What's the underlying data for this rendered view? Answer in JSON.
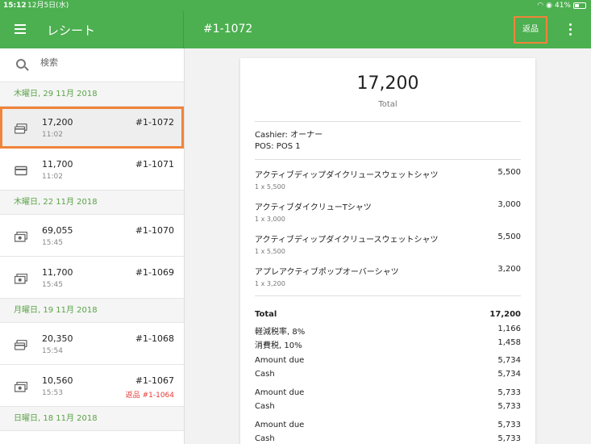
{
  "status": {
    "time": "15:12",
    "date": "12月5日(水)",
    "battery": "41%",
    "battery_level": 0.41
  },
  "appbar": {
    "title": "レシート",
    "receipt_title": "#1-1072",
    "refund_label": "返品"
  },
  "search": {
    "placeholder": "検索"
  },
  "groups": [
    {
      "date": "木曜日, 29 11月 2018",
      "items": [
        {
          "amount": "17,200",
          "time": "11:02",
          "number": "#1-1072",
          "icon": "card-stack-icon"
        },
        {
          "amount": "11,700",
          "time": "11:02",
          "number": "#1-1071",
          "icon": "card-icon"
        }
      ]
    },
    {
      "date": "木曜日, 22 11月 2018",
      "items": [
        {
          "amount": "69,055",
          "time": "15:45",
          "number": "#1-1070",
          "icon": "cash-icon"
        },
        {
          "amount": "11,700",
          "time": "15:45",
          "number": "#1-1069",
          "icon": "cash-icon"
        }
      ]
    },
    {
      "date": "月曜日, 19 11月 2018",
      "items": [
        {
          "amount": "20,350",
          "time": "15:54",
          "number": "#1-1068",
          "icon": "card-stack-icon"
        },
        {
          "amount": "10,560",
          "time": "15:53",
          "number": "#1-1067",
          "refund_note": "返品 #1-1064",
          "icon": "cash-icon"
        }
      ]
    },
    {
      "date": "日曜日, 18 11月 2018",
      "items": []
    }
  ],
  "receipt": {
    "total": "17,200",
    "total_label": "Total",
    "cashier": "Cashier: オーナー",
    "pos": "POS: POS 1",
    "lines": [
      {
        "name": "アクティブディップダイクリュースウェットシャツ",
        "qty": "1 x 5,500",
        "price": "5,500"
      },
      {
        "name": "アクティブダイクリューTシャツ",
        "qty": "1 x 3,000",
        "price": "3,000"
      },
      {
        "name": "アクティブディップダイクリュースウェットシャツ",
        "qty": "1 x 5,500",
        "price": "5,500"
      },
      {
        "name": "アプレアクティブポップオーバーシャツ",
        "qty": "1 x 3,200",
        "price": "3,200"
      }
    ],
    "summary": {
      "total_label": "Total",
      "total_value": "17,200",
      "tax1_label": "軽減税率,  8%",
      "tax1_value": "1,166",
      "tax2_label": "消費税,  10%",
      "tax2_value": "1,458"
    },
    "payments": [
      {
        "due_label": "Amount due",
        "due_value": "5,734",
        "method_label": "Cash",
        "method_value": "5,734"
      },
      {
        "due_label": "Amount due",
        "due_value": "5,733",
        "method_label": "Cash",
        "method_value": "5,733"
      },
      {
        "due_label": "Amount due",
        "due_value": "5,733",
        "method_label": "Cash",
        "method_value": "5,733"
      }
    ]
  },
  "colors": {
    "brand_green": "#4caf50",
    "highlight_orange": "#f0843a",
    "refund_red": "#e53935"
  }
}
